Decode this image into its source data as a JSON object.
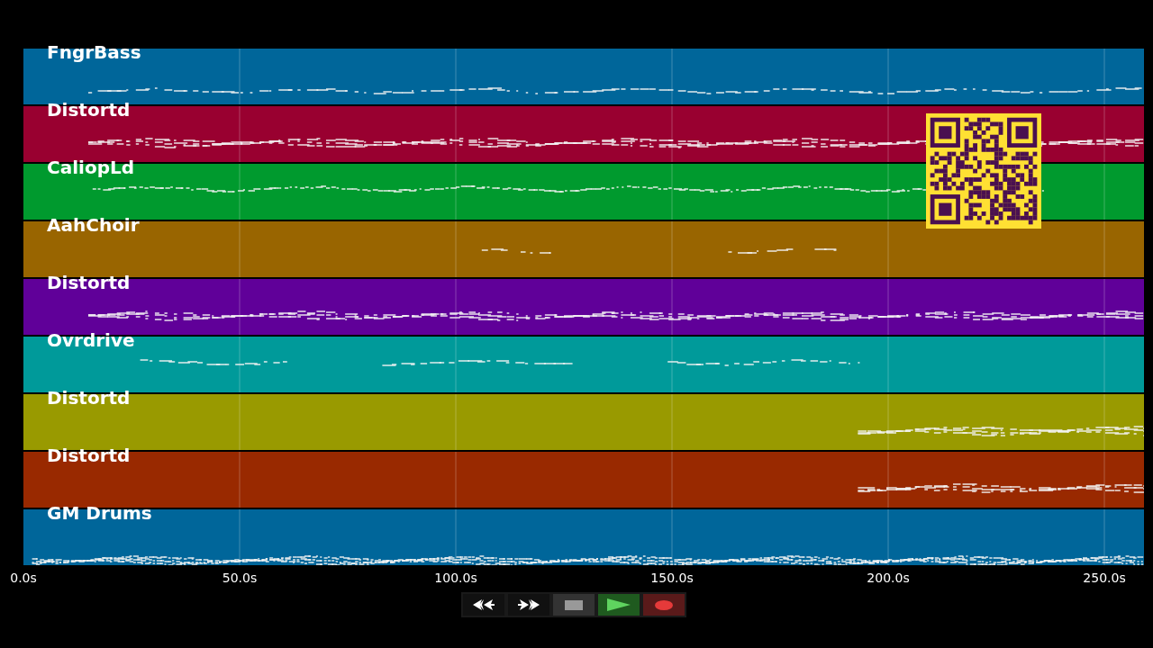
{
  "tracks": [
    {
      "name": "FngrBass",
      "color": "#00669a"
    },
    {
      "name": "Distortd",
      "color": "#990030"
    },
    {
      "name": "CaliopLd",
      "color": "#009a2e"
    },
    {
      "name": "AahChoir",
      "color": "#996500"
    },
    {
      "name": "Distortd",
      "color": "#600099"
    },
    {
      "name": "Ovrdrive",
      "color": "#009a9a"
    },
    {
      "name": "Distortd",
      "color": "#999a00"
    },
    {
      "name": "Distortd",
      "color": "#992900"
    },
    {
      "name": "GM Drums",
      "color": "#00669a"
    }
  ],
  "time_axis": {
    "ticks": [
      "0.0s",
      "50.0s",
      "100.0s",
      "150.0s",
      "200.0s",
      "250.0s"
    ]
  },
  "transport": [
    {
      "kind": "rewind"
    },
    {
      "kind": "fast-forward"
    },
    {
      "kind": "stop"
    },
    {
      "kind": "play"
    },
    {
      "kind": "record"
    }
  ]
}
